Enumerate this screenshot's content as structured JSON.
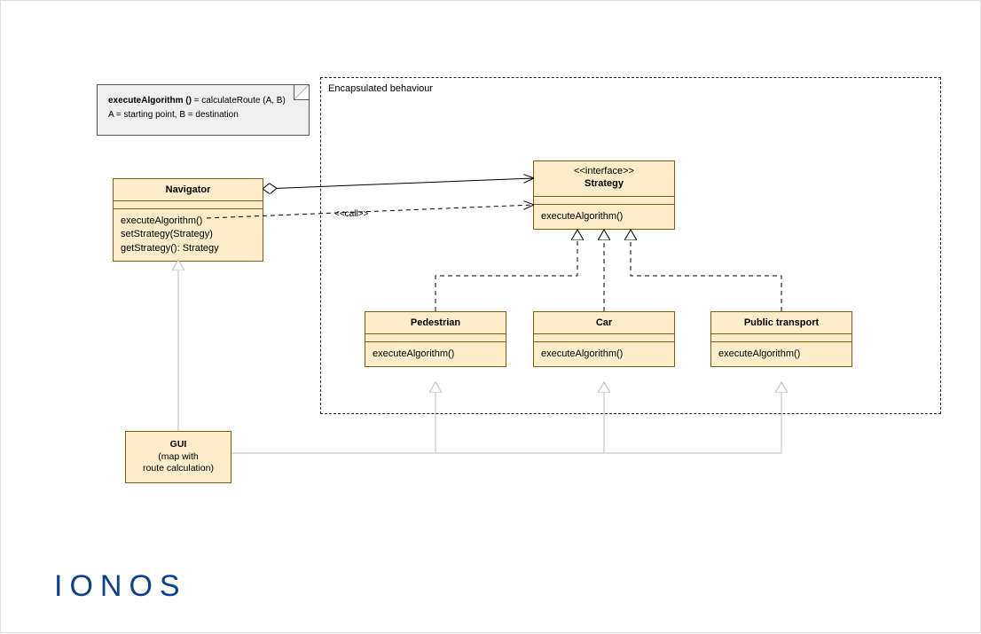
{
  "note": {
    "line1_bold": "executeAlgorithm ()",
    "line1_rest": " = calculateRoute (A, B)",
    "line2": "A = starting point, B = destination"
  },
  "frame": {
    "title": "Encapsulated behaviour"
  },
  "navigator": {
    "title": "Navigator",
    "ops": [
      "executeAlgorithm()",
      "setStrategy(Strategy)",
      "getStrategy(): Strategy"
    ]
  },
  "strategy": {
    "stereotype": "<<interface>>",
    "title": "Strategy",
    "ops": [
      "executeAlgorithm()"
    ]
  },
  "pedestrian": {
    "title": "Pedestrian",
    "ops": [
      "executeAlgorithm()"
    ]
  },
  "car": {
    "title": "Car",
    "ops": [
      "executeAlgorithm()"
    ]
  },
  "public_transport": {
    "title": "Public transport",
    "ops": [
      "executeAlgorithm()"
    ]
  },
  "gui": {
    "line1": "GUI",
    "line2": "(map with",
    "line3": "route calculation)"
  },
  "call_label": "<<call>>",
  "logo": "IONOS"
}
